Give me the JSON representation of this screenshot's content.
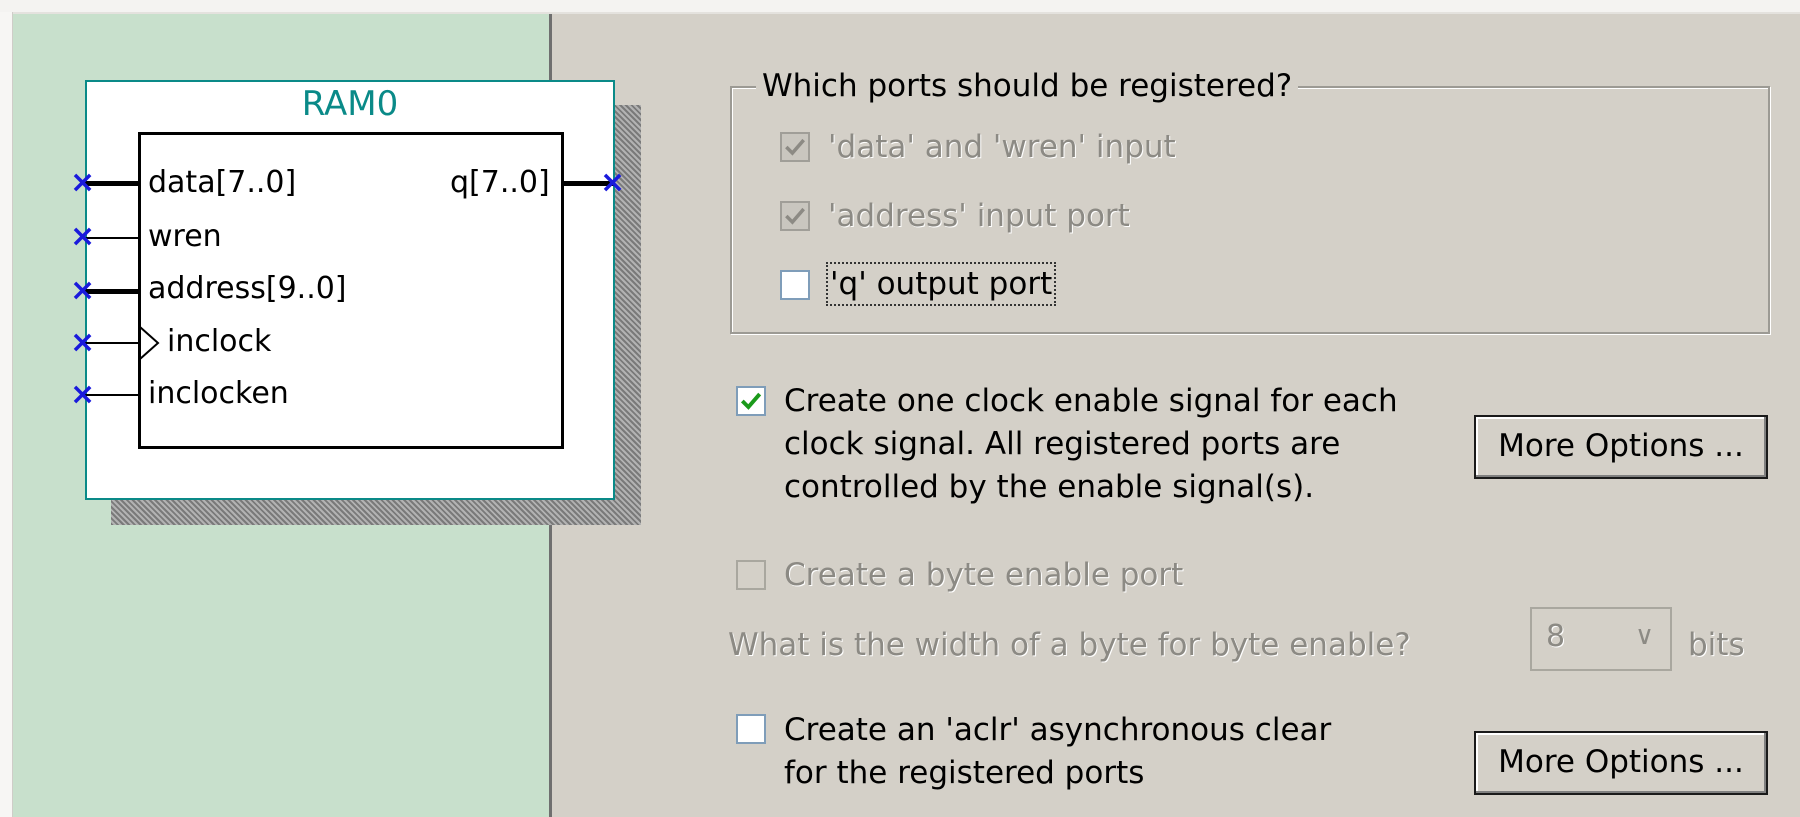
{
  "symbol": {
    "title": "RAM0",
    "ports": {
      "data": "data[7..0]",
      "wren": "wren",
      "address": "address[9..0]",
      "inclock": "inclock",
      "inclocken": "inclocken",
      "q": "q[7..0]"
    },
    "unconnected_mark": "×"
  },
  "registered_ports": {
    "legend": "Which ports should be registered?",
    "data_wren": {
      "label": "'data' and 'wren' input",
      "checked": true,
      "enabled": false
    },
    "address": {
      "label": "'address' input port",
      "checked": true,
      "enabled": false
    },
    "q_output": {
      "label": "'q' output port",
      "checked": false,
      "enabled": true
    }
  },
  "clock_enable": {
    "line1": "Create one clock enable signal for each",
    "line2": "clock signal.  All registered ports are",
    "line3": "controlled by the enable signal(s).",
    "checked": true,
    "more_options": "More Options ..."
  },
  "byte_enable": {
    "label": "Create a byte enable port",
    "checked": false,
    "enabled": false,
    "width_question": "What is the width of a byte for byte enable?",
    "width_value": "8",
    "width_unit": "bits"
  },
  "aclr": {
    "line1": "Create an 'aclr' asynchronous clear",
    "line2": "for the registered ports",
    "checked": false,
    "more_options": "More Options ..."
  },
  "colors": {
    "symbol_bg": "#c8e0cc",
    "symbol_border": "#0a8a88",
    "dialog_bg": "#d4d0c8",
    "check_green": "#1a9a1a",
    "unconnected_blue": "#1a1adc"
  }
}
